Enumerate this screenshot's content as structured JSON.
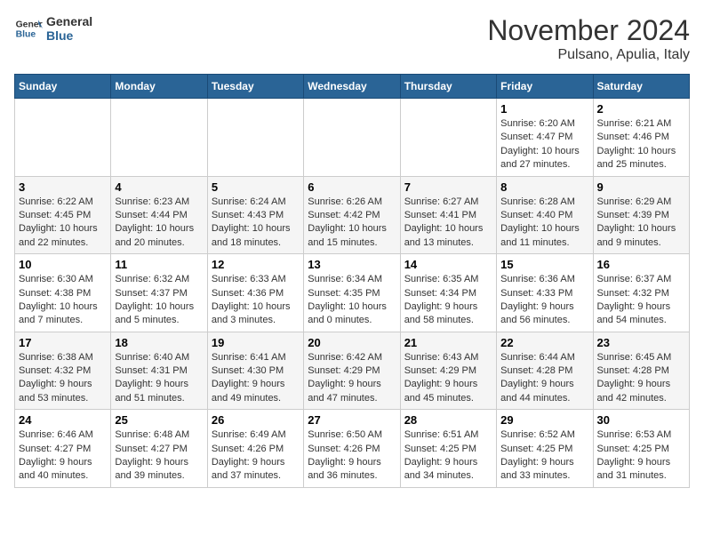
{
  "header": {
    "logo_general": "General",
    "logo_blue": "Blue",
    "month": "November 2024",
    "location": "Pulsano, Apulia, Italy"
  },
  "weekdays": [
    "Sunday",
    "Monday",
    "Tuesday",
    "Wednesday",
    "Thursday",
    "Friday",
    "Saturday"
  ],
  "weeks": [
    [
      {
        "day": "",
        "info": ""
      },
      {
        "day": "",
        "info": ""
      },
      {
        "day": "",
        "info": ""
      },
      {
        "day": "",
        "info": ""
      },
      {
        "day": "",
        "info": ""
      },
      {
        "day": "1",
        "info": "Sunrise: 6:20 AM\nSunset: 4:47 PM\nDaylight: 10 hours\nand 27 minutes."
      },
      {
        "day": "2",
        "info": "Sunrise: 6:21 AM\nSunset: 4:46 PM\nDaylight: 10 hours\nand 25 minutes."
      }
    ],
    [
      {
        "day": "3",
        "info": "Sunrise: 6:22 AM\nSunset: 4:45 PM\nDaylight: 10 hours\nand 22 minutes."
      },
      {
        "day": "4",
        "info": "Sunrise: 6:23 AM\nSunset: 4:44 PM\nDaylight: 10 hours\nand 20 minutes."
      },
      {
        "day": "5",
        "info": "Sunrise: 6:24 AM\nSunset: 4:43 PM\nDaylight: 10 hours\nand 18 minutes."
      },
      {
        "day": "6",
        "info": "Sunrise: 6:26 AM\nSunset: 4:42 PM\nDaylight: 10 hours\nand 15 minutes."
      },
      {
        "day": "7",
        "info": "Sunrise: 6:27 AM\nSunset: 4:41 PM\nDaylight: 10 hours\nand 13 minutes."
      },
      {
        "day": "8",
        "info": "Sunrise: 6:28 AM\nSunset: 4:40 PM\nDaylight: 10 hours\nand 11 minutes."
      },
      {
        "day": "9",
        "info": "Sunrise: 6:29 AM\nSunset: 4:39 PM\nDaylight: 10 hours\nand 9 minutes."
      }
    ],
    [
      {
        "day": "10",
        "info": "Sunrise: 6:30 AM\nSunset: 4:38 PM\nDaylight: 10 hours\nand 7 minutes."
      },
      {
        "day": "11",
        "info": "Sunrise: 6:32 AM\nSunset: 4:37 PM\nDaylight: 10 hours\nand 5 minutes."
      },
      {
        "day": "12",
        "info": "Sunrise: 6:33 AM\nSunset: 4:36 PM\nDaylight: 10 hours\nand 3 minutes."
      },
      {
        "day": "13",
        "info": "Sunrise: 6:34 AM\nSunset: 4:35 PM\nDaylight: 10 hours\nand 0 minutes."
      },
      {
        "day": "14",
        "info": "Sunrise: 6:35 AM\nSunset: 4:34 PM\nDaylight: 9 hours\nand 58 minutes."
      },
      {
        "day": "15",
        "info": "Sunrise: 6:36 AM\nSunset: 4:33 PM\nDaylight: 9 hours\nand 56 minutes."
      },
      {
        "day": "16",
        "info": "Sunrise: 6:37 AM\nSunset: 4:32 PM\nDaylight: 9 hours\nand 54 minutes."
      }
    ],
    [
      {
        "day": "17",
        "info": "Sunrise: 6:38 AM\nSunset: 4:32 PM\nDaylight: 9 hours\nand 53 minutes."
      },
      {
        "day": "18",
        "info": "Sunrise: 6:40 AM\nSunset: 4:31 PM\nDaylight: 9 hours\nand 51 minutes."
      },
      {
        "day": "19",
        "info": "Sunrise: 6:41 AM\nSunset: 4:30 PM\nDaylight: 9 hours\nand 49 minutes."
      },
      {
        "day": "20",
        "info": "Sunrise: 6:42 AM\nSunset: 4:29 PM\nDaylight: 9 hours\nand 47 minutes."
      },
      {
        "day": "21",
        "info": "Sunrise: 6:43 AM\nSunset: 4:29 PM\nDaylight: 9 hours\nand 45 minutes."
      },
      {
        "day": "22",
        "info": "Sunrise: 6:44 AM\nSunset: 4:28 PM\nDaylight: 9 hours\nand 44 minutes."
      },
      {
        "day": "23",
        "info": "Sunrise: 6:45 AM\nSunset: 4:28 PM\nDaylight: 9 hours\nand 42 minutes."
      }
    ],
    [
      {
        "day": "24",
        "info": "Sunrise: 6:46 AM\nSunset: 4:27 PM\nDaylight: 9 hours\nand 40 minutes."
      },
      {
        "day": "25",
        "info": "Sunrise: 6:48 AM\nSunset: 4:27 PM\nDaylight: 9 hours\nand 39 minutes."
      },
      {
        "day": "26",
        "info": "Sunrise: 6:49 AM\nSunset: 4:26 PM\nDaylight: 9 hours\nand 37 minutes."
      },
      {
        "day": "27",
        "info": "Sunrise: 6:50 AM\nSunset: 4:26 PM\nDaylight: 9 hours\nand 36 minutes."
      },
      {
        "day": "28",
        "info": "Sunrise: 6:51 AM\nSunset: 4:25 PM\nDaylight: 9 hours\nand 34 minutes."
      },
      {
        "day": "29",
        "info": "Sunrise: 6:52 AM\nSunset: 4:25 PM\nDaylight: 9 hours\nand 33 minutes."
      },
      {
        "day": "30",
        "info": "Sunrise: 6:53 AM\nSunset: 4:25 PM\nDaylight: 9 hours\nand 31 minutes."
      }
    ]
  ]
}
